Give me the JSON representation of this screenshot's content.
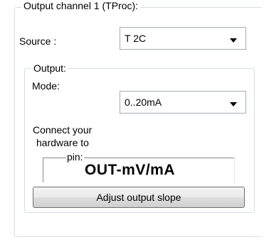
{
  "channel_group": {
    "title": "Output channel 1 (TProc):"
  },
  "source": {
    "label": "Source :",
    "value": "T 2C"
  },
  "output_group": {
    "title": "Output:",
    "mode_label": "Mode:",
    "mode_value": "0..20mA",
    "connect_line1": "Connect your",
    "connect_line2": "hardware to",
    "pin_label": "pin:",
    "pin_value": "OUT-mV/mA",
    "adjust_button": "Adjust output slope"
  },
  "icons": {
    "dropdown": "chevron-down-icon"
  }
}
